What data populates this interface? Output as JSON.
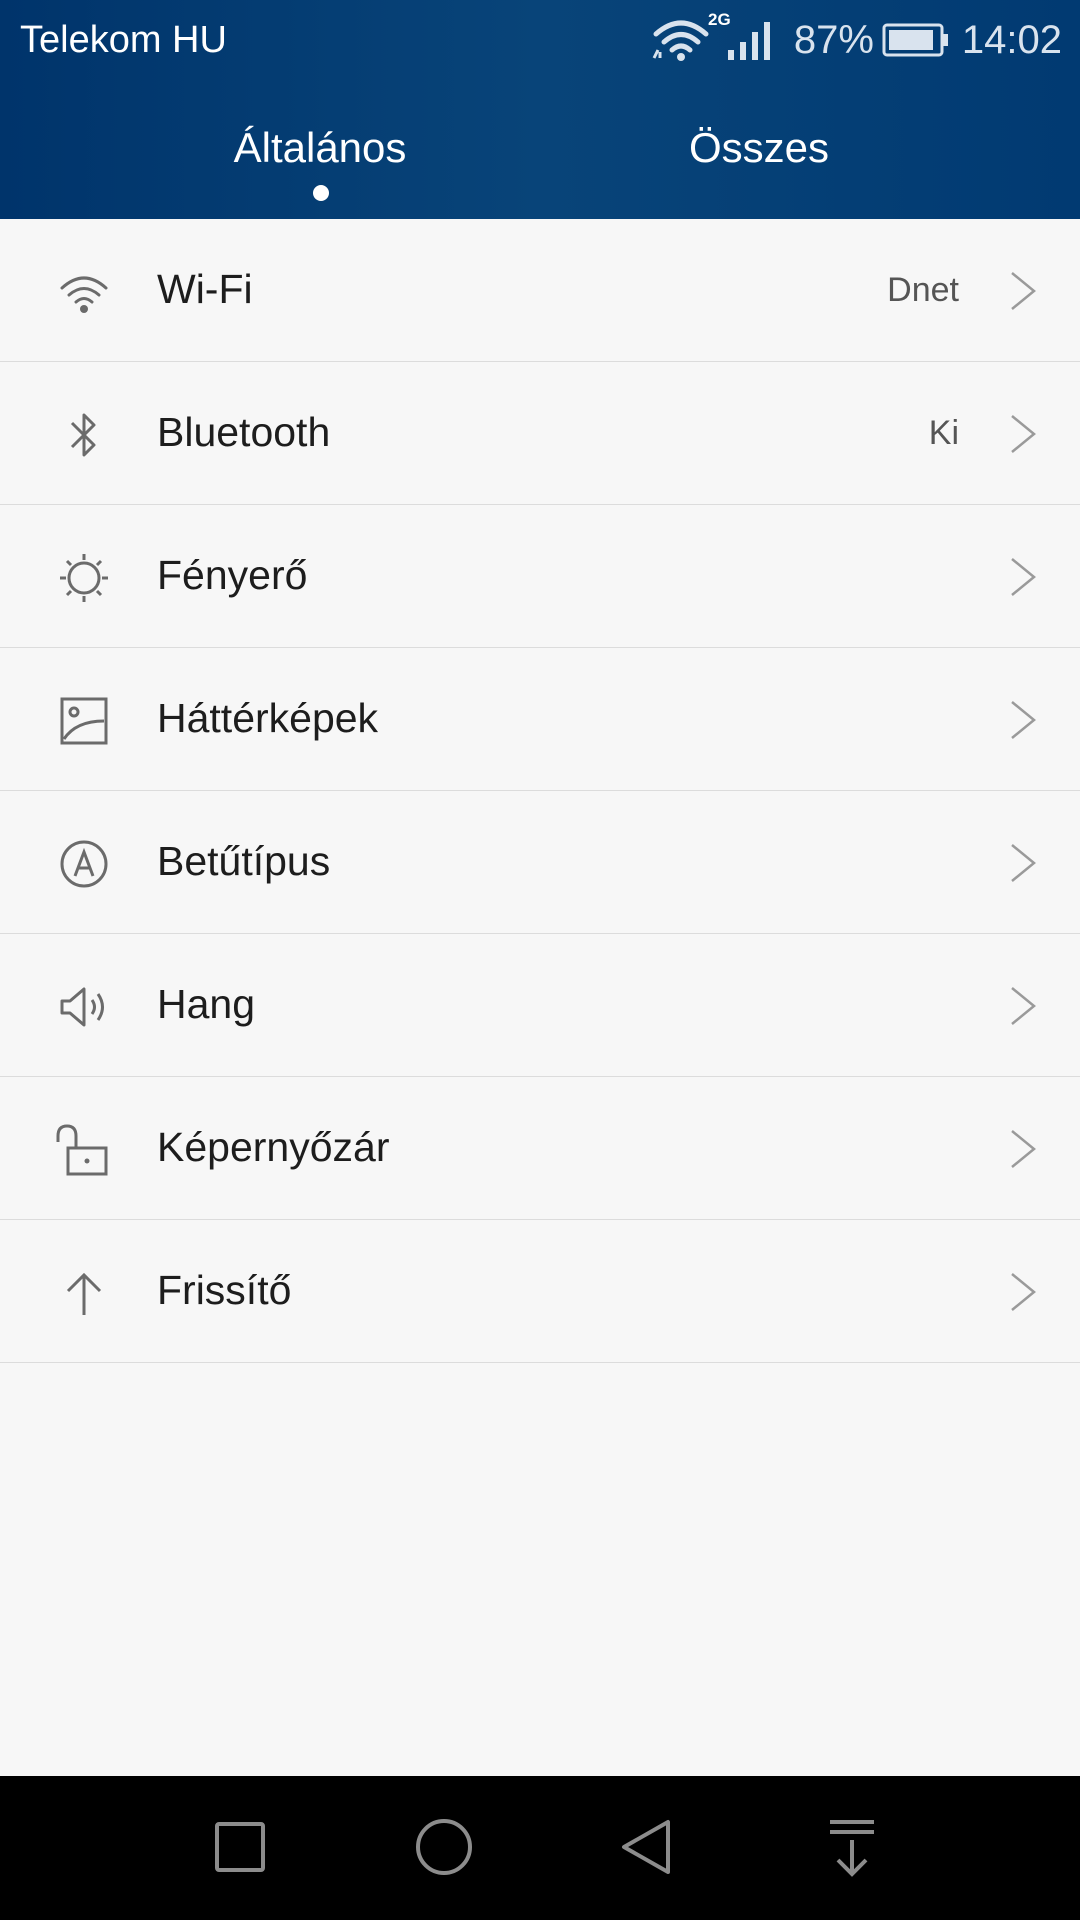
{
  "status_bar": {
    "carrier": "Telekom HU",
    "network_type": "2G",
    "battery_percent": "87%",
    "time": "14:02",
    "icons": [
      "wifi-icon",
      "signal-icon",
      "battery-icon"
    ]
  },
  "tabs": [
    {
      "label": "Általános",
      "active": true
    },
    {
      "label": "Összes",
      "active": false
    }
  ],
  "settings": {
    "items": [
      {
        "label": "Wi-Fi",
        "value": "Dnet",
        "icon": "wifi-icon"
      },
      {
        "label": "Bluetooth",
        "value": "Ki",
        "icon": "bluetooth-icon"
      },
      {
        "label": "Fényerő",
        "value": "",
        "icon": "brightness-icon"
      },
      {
        "label": "Háttérképek",
        "value": "",
        "icon": "wallpaper-icon"
      },
      {
        "label": "Betűtípus",
        "value": "",
        "icon": "font-icon"
      },
      {
        "label": "Hang",
        "value": "",
        "icon": "speaker-icon"
      },
      {
        "label": "Képernyőzár",
        "value": "",
        "icon": "unlock-icon"
      },
      {
        "label": "Frissítő",
        "value": "",
        "icon": "arrow-up-icon"
      }
    ]
  },
  "nav_bar": {
    "buttons": [
      "recents-icon",
      "home-icon",
      "back-icon",
      "notification-pull-icon"
    ]
  },
  "colors": {
    "header_bg": "#084479",
    "list_bg": "#f7f7f7",
    "text_primary": "#1d1d1d",
    "text_secondary": "#555555",
    "divider": "#dcdcdc",
    "navbar_bg": "#000000"
  }
}
